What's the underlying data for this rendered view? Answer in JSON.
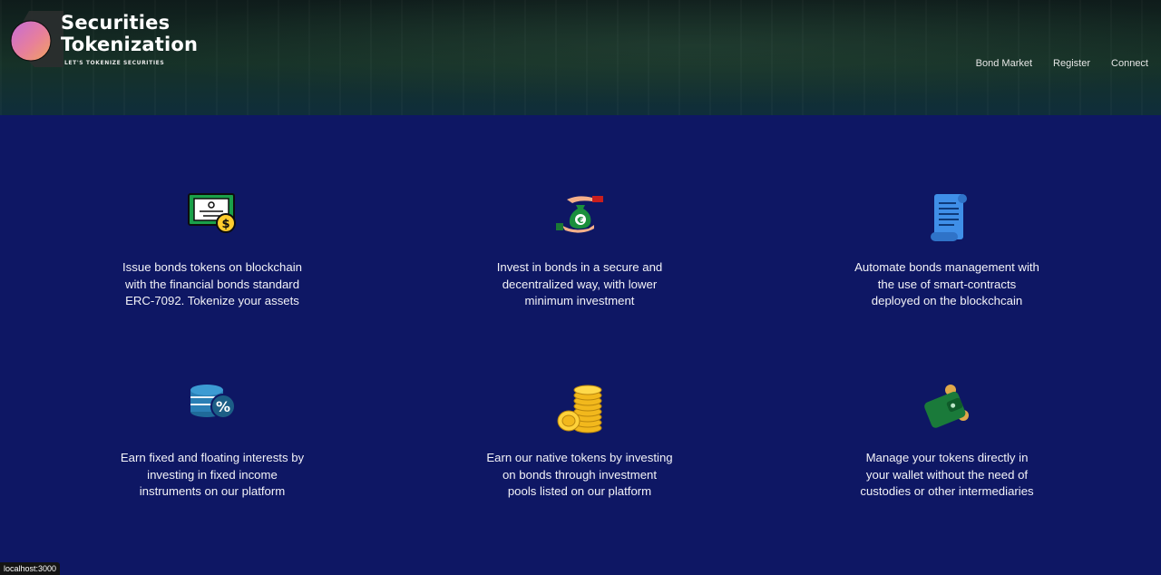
{
  "brand": {
    "title_line1": "Securities",
    "title_line2": "Tokenization",
    "tagline": "LET'S TOKENIZE SECURITIES"
  },
  "nav": {
    "items": [
      {
        "label": "Bond Market"
      },
      {
        "label": "Register"
      },
      {
        "label": "Connect"
      }
    ]
  },
  "features": [
    {
      "icon": "bond-certificate-icon",
      "lines": [
        "Issue bonds tokens on blockchain",
        "with the financial bonds standard",
        "ERC-7092. Tokenize your assets"
      ]
    },
    {
      "icon": "money-bag-hand-icon",
      "lines": [
        "Invest in bonds in a secure and",
        "decentralized way, with lower",
        "minimum investment"
      ]
    },
    {
      "icon": "scroll-document-icon",
      "lines": [
        "Automate bonds management with",
        "the use of smart-contracts",
        "deployed on the blockchcain"
      ]
    },
    {
      "icon": "coins-percent-icon",
      "lines": [
        "Earn fixed and floating interests by",
        "investing in fixed income",
        "instruments on our platform"
      ]
    },
    {
      "icon": "gold-coins-stack-icon",
      "lines": [
        "Earn our native tokens by investing",
        "on bonds through investment",
        "pools listed on our platform"
      ]
    },
    {
      "icon": "wallet-icon",
      "lines": [
        "Manage your tokens directly in",
        "your wallet without the need of",
        "custodies or other intermediaries"
      ]
    }
  ],
  "status_bar": {
    "text": "localhost:3000"
  },
  "colors": {
    "page_background": "#0e1764",
    "header_background": "#163127",
    "text": "#ffffff"
  }
}
